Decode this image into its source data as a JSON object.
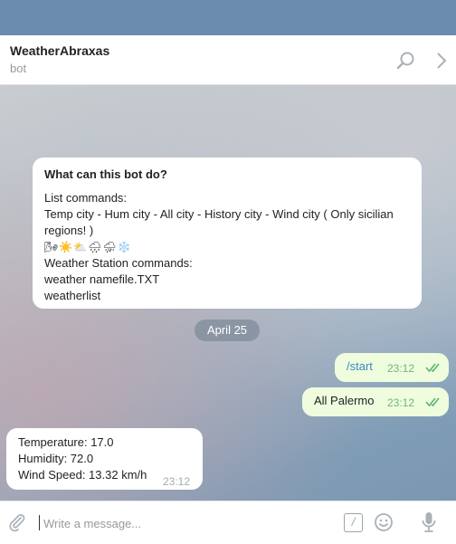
{
  "header": {
    "name": "WeatherAbraxas",
    "subtitle": "bot"
  },
  "info_card": {
    "title": "What can this bot do?",
    "lines": [
      "List commands:",
      "Temp city - Hum city - All city - History city - Wind city ( Only sicilian regions! )",
      "🌬☀️⛅🌧⛈❄️",
      "Weather Station commands:",
      "weather namefile.TXT",
      "weatherlist"
    ]
  },
  "date_badge": "April 25",
  "messages": {
    "out1": {
      "text": "/start",
      "time": "23:12"
    },
    "out2": {
      "text": "All Palermo",
      "time": "23:12"
    },
    "in1": {
      "lines": [
        "Temperature: 17.0",
        "Humidity: 72.0",
        "Wind Speed: 13.32 km/h"
      ],
      "time": "23:12"
    }
  },
  "composer": {
    "placeholder": "Write a message...",
    "command_symbol": "/"
  },
  "icons": [
    "search-icon",
    "chevron-right-icon",
    "read-receipt-icon",
    "attach-icon",
    "bot-command-icon",
    "emoji-icon",
    "microphone-icon"
  ]
}
